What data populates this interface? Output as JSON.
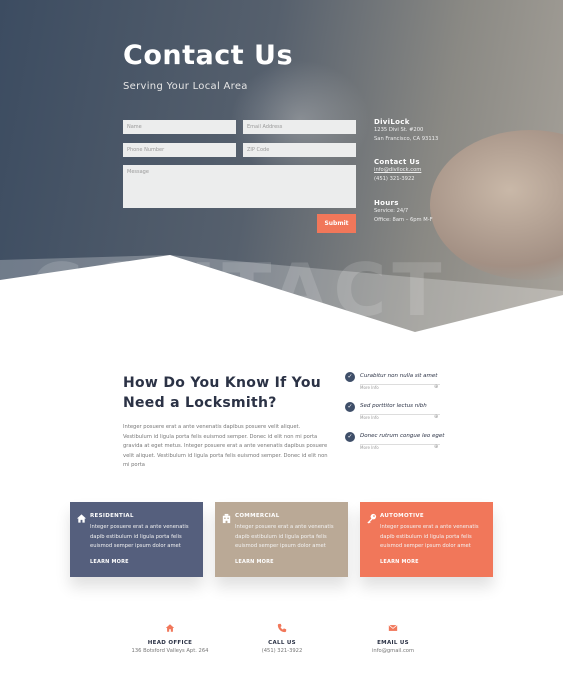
{
  "hero": {
    "title": "Contact Us",
    "subtitle": "Serving Your Local Area",
    "watermark": "CONTACT",
    "form": {
      "name_placeholder": "Name",
      "email_placeholder": "Email Address",
      "phone_placeholder": "Phone Number",
      "zip_placeholder": "ZIP Code",
      "message_placeholder": "Message",
      "submit_label": "Submit"
    },
    "info": {
      "company": "DiviLock",
      "address_line1": "1235 Divi St. #200",
      "address_line2": "San Francisco, CA 93113",
      "contact_heading": "Contact Us",
      "contact_email": "info@divilock.com",
      "contact_phone": "(451) 321-3922",
      "hours_heading": "Hours",
      "hours_service": "Service: 24/7",
      "hours_office": "Office: 8am – 6pm M-F"
    }
  },
  "locksmith": {
    "title": "How Do You Know If You Need a Locksmith?",
    "body": "Integer posuere erat a ante venenatis dapibus posuere velit aliquet. Vestibulum id ligula porta felis euismod semper. Donec id elit non mi porta gravida at eget metus. Integer posuere erat a ante venenatis dapibus posuere velit aliquet. Vestibulum id ligula porta felis euismod semper. Donec id elit non mi porta",
    "checklist": [
      {
        "label": "Curabitur non nulla sit amet",
        "more": "More Info"
      },
      {
        "label": "Sed porttitor lectus nibh",
        "more": "More Info"
      },
      {
        "label": "Donec rutrum congue leo eget",
        "more": "More Info"
      }
    ]
  },
  "cards": [
    {
      "icon": "home-icon",
      "title": "RESIDENTIAL",
      "body": "Integer posuere erat a ante venenatis dapib estibulum id ligula porta felis euismod semper ipsum dolor amet",
      "link": "LEARN MORE",
      "color": "#555f7d"
    },
    {
      "icon": "building-icon",
      "title": "COMMERCIAL",
      "body": "Integer posuere erat a ante venenatis dapib estibulum id ligula porta felis euismod semper ipsum dolor amet",
      "link": "LEARN MORE",
      "color": "#baa996"
    },
    {
      "icon": "key-icon",
      "title": "AUTOMOTIVE",
      "body": "Integer posuere erat a ante venenatis dapib estibulum id ligula porta felis euismod semper ipsum dolor amet",
      "link": "LEARN MORE",
      "color": "#f1775a"
    }
  ],
  "footer": [
    {
      "icon": "home-icon",
      "title": "HEAD OFFICE",
      "value": "136 Botsford Valleys Apt. 264"
    },
    {
      "icon": "phone-icon",
      "title": "CALL US",
      "value": "(451) 321-3922"
    },
    {
      "icon": "mail-icon",
      "title": "EMAIL US",
      "value": "info@gmail.com"
    }
  ],
  "accent_color": "#f1775a"
}
